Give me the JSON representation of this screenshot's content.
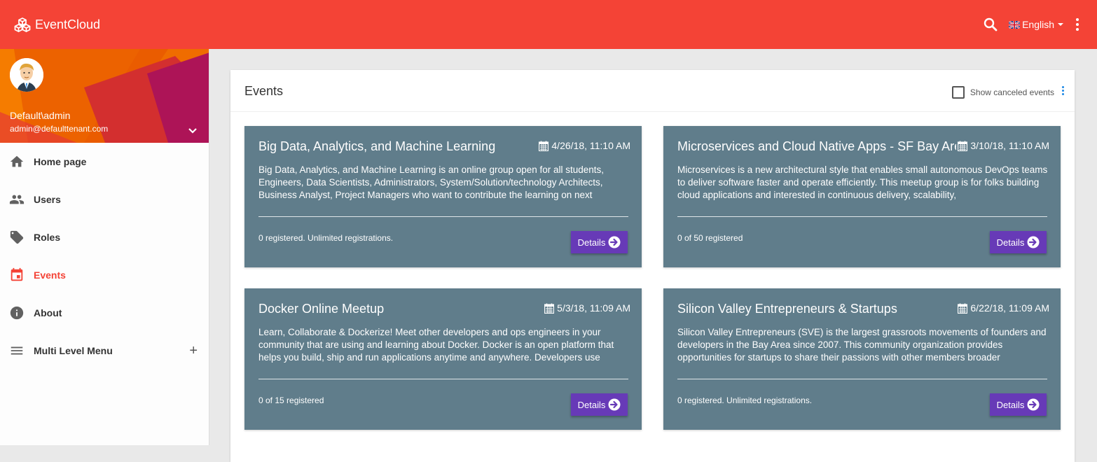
{
  "app": {
    "title": "EventCloud",
    "language": "English",
    "accent_color": "#f44336",
    "icons": [
      "cubes-icon",
      "search-icon",
      "uk-flag-icon",
      "more-vert-icon"
    ]
  },
  "user": {
    "name": "Default\\admin",
    "email": "admin@defaulttenant.com"
  },
  "sidebar": {
    "items": [
      {
        "label": "Home page",
        "icon": "home-icon",
        "active": false
      },
      {
        "label": "Users",
        "icon": "people-icon",
        "active": false
      },
      {
        "label": "Roles",
        "icon": "tag-icon",
        "active": false
      },
      {
        "label": "Events",
        "icon": "calendar-icon",
        "active": true
      },
      {
        "label": "About",
        "icon": "info-icon",
        "active": false
      },
      {
        "label": "Multi Level Menu",
        "icon": "menu-icon",
        "active": false,
        "expand": "+"
      }
    ]
  },
  "main": {
    "title": "Events",
    "show_canceled_label": "Show canceled events",
    "show_canceled_checked": false,
    "events": [
      {
        "title": "Big Data, Analytics, and Machine Learning",
        "date": "4/26/18, 11:10 AM",
        "description": "Big Data, Analytics, and Machine Learning is an online group open for all students, Engineers, Data Scientists, Administrators, System/Solution/technology Architects, Business Analyst, Project Managers who want to contribute the learning on next",
        "registration": "0 registered. Unlimited registrations.",
        "button": "Details"
      },
      {
        "title": "Microservices and Cloud Native Apps - SF Bay Area",
        "date": "3/10/18, 11:10 AM",
        "description": "Microservices is a new architectural style that enables small autonomous DevOps teams to deliver software faster and operate efficiently. This meetup group is for folks building cloud applications and interested in continuous delivery, scalability,",
        "registration": "0 of 50 registered",
        "button": "Details"
      },
      {
        "title": "Docker Online Meetup",
        "date": "5/3/18, 11:09 AM",
        "description": "Learn, Collaborate & Dockerize! Meet other developers and ops engineers in your community that are using and learning about Docker. Docker is an open platform that helps you build, ship and run applications anytime and anywhere. Developers use",
        "registration": "0 of 15 registered",
        "button": "Details"
      },
      {
        "title": "Silicon Valley Entrepreneurs & Startups",
        "date": "6/22/18, 11:09 AM",
        "description": "Silicon Valley Entrepreneurs (SVE) is the largest grassroots movements of founders and developers in the Bay Area since 2007. This community organization provides opportunities for startups to share their passions with other members broader",
        "registration": "0 registered. Unlimited registrations.",
        "button": "Details"
      }
    ]
  }
}
